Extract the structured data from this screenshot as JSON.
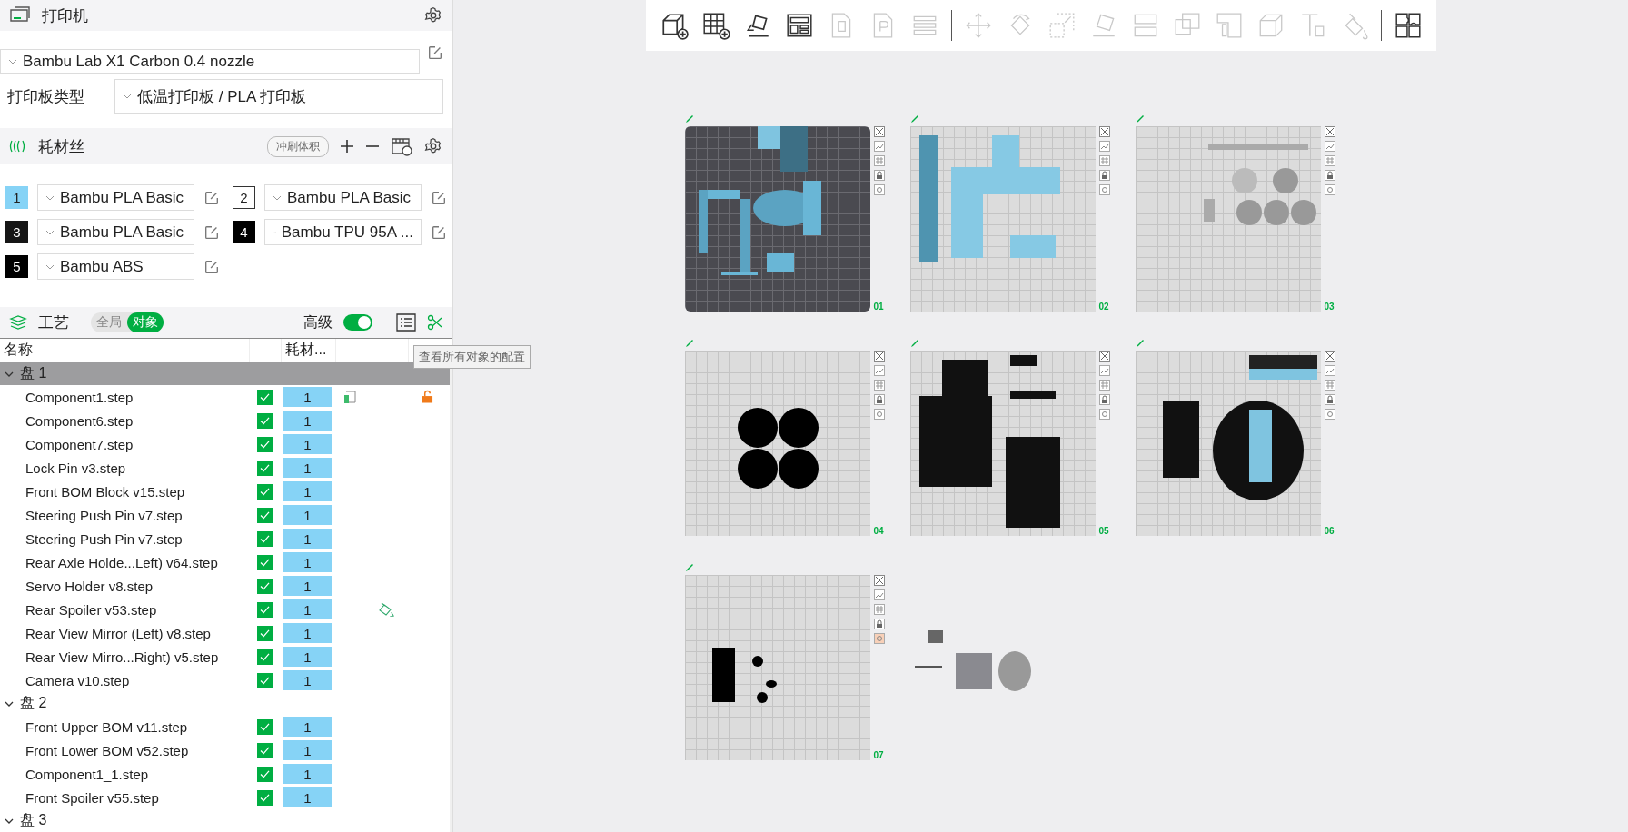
{
  "printer": {
    "title": "打印机",
    "preset": "Bambu Lab X1 Carbon 0.4 nozzle",
    "plate_type_label": "打印板类型",
    "plate_type": "低温打印板 / PLA 打印板"
  },
  "filament": {
    "title": "耗材丝",
    "flush_button": "冲刷体积",
    "slots": [
      {
        "number": "1",
        "name": "Bambu PLA Basic",
        "color": "#86d3f6"
      },
      {
        "number": "2",
        "name": "Bambu PLA Basic",
        "color": "#ffffff"
      },
      {
        "number": "3",
        "name": "Bambu PLA Basic",
        "color": "#161616"
      },
      {
        "number": "4",
        "name": "Bambu TPU 95A ...",
        "color": "#000000"
      },
      {
        "number": "5",
        "name": "Bambu ABS",
        "color": "#000000"
      }
    ]
  },
  "process": {
    "title": "工艺",
    "scopes": [
      {
        "label": "全局",
        "selected": false
      },
      {
        "label": "对象",
        "selected": true
      }
    ],
    "advanced_label": "高级",
    "advanced_on": true,
    "tooltip": "查看所有对象的配置"
  },
  "table": {
    "columns": [
      "名称",
      "耗材..."
    ],
    "groups": [
      {
        "label": "盘 1",
        "expanded": true,
        "selected": true,
        "children": [
          {
            "name": "Component1.step",
            "checked": true,
            "filament": "1",
            "custom_settings": true,
            "unlocked": true
          },
          {
            "name": "Component6.step",
            "checked": true,
            "filament": "1"
          },
          {
            "name": "Component7.step",
            "checked": true,
            "filament": "1"
          },
          {
            "name": "Lock Pin v3.step",
            "checked": true,
            "filament": "1"
          },
          {
            "name": "Front BOM Block v15.step",
            "checked": true,
            "filament": "1"
          },
          {
            "name": "Steering Push Pin v7.step",
            "checked": true,
            "filament": "1"
          },
          {
            "name": "Steering Push Pin v7.step",
            "checked": true,
            "filament": "1"
          },
          {
            "name": "Rear Axle Holde...Left) v64.step",
            "checked": true,
            "filament": "1"
          },
          {
            "name": "Servo Holder v8.step",
            "checked": true,
            "filament": "1"
          },
          {
            "name": "Rear Spoiler v53.step",
            "checked": true,
            "filament": "1",
            "painted": true
          },
          {
            "name": "Rear View Mirror (Left) v8.step",
            "checked": true,
            "filament": "1"
          },
          {
            "name": "Rear View Mirro...Right) v5.step",
            "checked": true,
            "filament": "1"
          },
          {
            "name": "Camera v10.step",
            "checked": true,
            "filament": "1"
          }
        ]
      },
      {
        "label": "盘 2",
        "expanded": true,
        "selected": false,
        "children": [
          {
            "name": "Front Upper BOM v11.step",
            "checked": true,
            "filament": "1"
          },
          {
            "name": "Front Lower BOM v52.step",
            "checked": true,
            "filament": "1"
          },
          {
            "name": "Component1_1.step",
            "checked": true,
            "filament": "1"
          },
          {
            "name": "Front Spoiler v55.step",
            "checked": true,
            "filament": "1"
          }
        ]
      },
      {
        "label": "盘 3",
        "expanded": true,
        "selected": false
      }
    ]
  },
  "toolbar": [
    {
      "kind": "tool",
      "disabled": false
    },
    {
      "kind": "tool",
      "disabled": false
    },
    {
      "kind": "tool",
      "disabled": false
    },
    {
      "kind": "tool",
      "disabled": false
    },
    {
      "kind": "tool",
      "disabled": true
    },
    {
      "kind": "tool",
      "disabled": true
    },
    {
      "kind": "tool",
      "disabled": true
    },
    {
      "kind": "separator"
    },
    {
      "kind": "tool",
      "disabled": true
    },
    {
      "kind": "tool",
      "disabled": true
    },
    {
      "kind": "tool",
      "disabled": true
    },
    {
      "kind": "tool",
      "disabled": true
    },
    {
      "kind": "tool",
      "disabled": true
    },
    {
      "kind": "tool",
      "disabled": true
    },
    {
      "kind": "tool",
      "disabled": true
    },
    {
      "kind": "tool",
      "disabled": true
    },
    {
      "kind": "tool",
      "disabled": true
    },
    {
      "kind": "tool",
      "disabled": true
    },
    {
      "kind": "separator"
    },
    {
      "kind": "tool",
      "disabled": false
    }
  ],
  "plates": [
    {
      "label": "01",
      "selected": true
    },
    {
      "label": "02",
      "selected": false
    },
    {
      "label": "03",
      "selected": false
    },
    {
      "label": "04",
      "selected": false
    },
    {
      "label": "05",
      "selected": false
    },
    {
      "label": "06",
      "selected": false
    },
    {
      "label": "07",
      "selected": false
    }
  ]
}
